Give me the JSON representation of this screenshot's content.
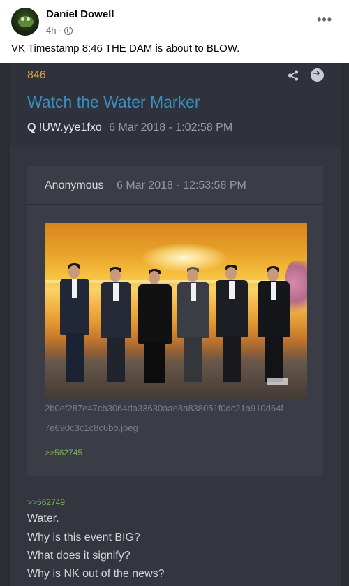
{
  "post": {
    "author": "Daniel Dowell",
    "time": "4h",
    "separator": "·",
    "text": "VK Timestamp 8:46 THE DAM is about to BLOW.",
    "more_label": "•••"
  },
  "qpost": {
    "number": "846",
    "title": "Watch the Water Marker",
    "name": "Q",
    "tripcode": "!UW.yye1fxo",
    "date": "6 Mar 2018 - 1:02:58 PM",
    "quote": {
      "name": "Anonymous",
      "date": "6 Mar 2018 - 12:53:58 PM",
      "filename_line1": "2b0ef287e47cb3064da33630aae8a838051f0dc21a910d64f",
      "filename_line2": "7e690c3c1c8c6bb.jpeg",
      "reply_link": ">>562745"
    },
    "reply_link": ">>562749",
    "lines": [
      "Water.",
      "Why is this event BIG?",
      "What does it signify?",
      "Why is NK out of the news?"
    ]
  },
  "colors": {
    "accent_title": "#3a8fc2",
    "post_number": "#d9a441",
    "reply_link": "#74b45a"
  },
  "icons": [
    "globe-icon",
    "more-icon",
    "share-icon",
    "arrow-right-icon"
  ]
}
